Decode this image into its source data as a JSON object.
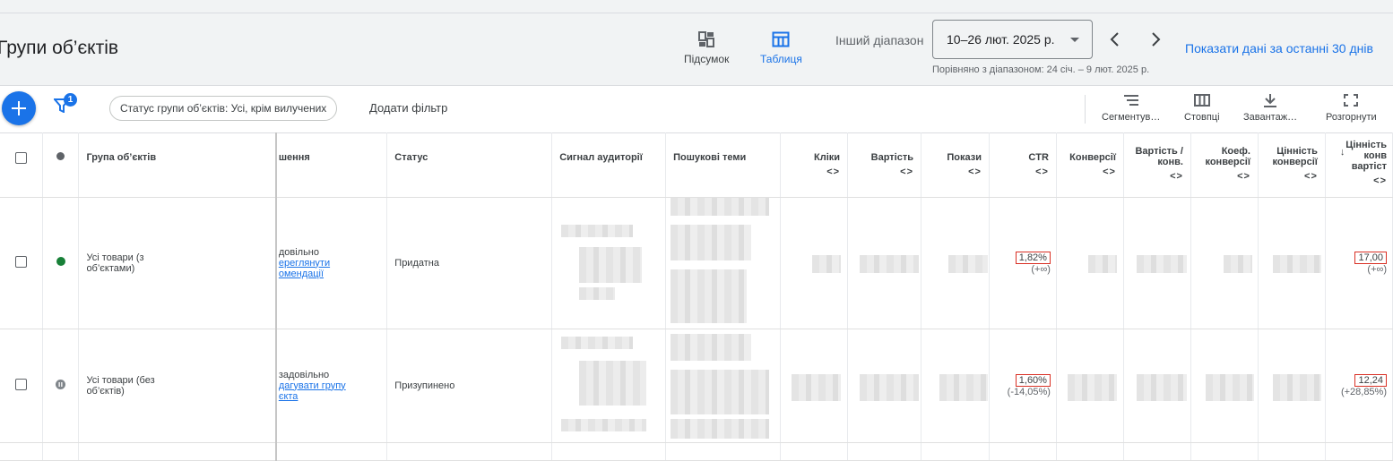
{
  "header": {
    "page_title": "Групи об’єктів",
    "view_summary": "Підсумок",
    "view_table": "Таблиця",
    "range_label": "Інший діапазон",
    "range_value": "10–26 лют. 2025 р.",
    "compare_text": "Порівняно з діапазоном: 24 січ. – 9 лют. 2025 р.",
    "last30_link": "Показати дані за останні 30 днів"
  },
  "toolbar": {
    "filter_badge": "1",
    "status_chip": "Статус групи об’єктів: Усі, крім вилучених",
    "add_filter": "Додати фільтр",
    "segment": "Сегментув…",
    "columns": "Стовпці",
    "download": "Завантаж…",
    "expand": "Розгорнути"
  },
  "table": {
    "headers": {
      "asset_group": "Група об’єктів",
      "ad_strength": "шення",
      "status": "Статус",
      "audience_signal": "Сигнал аудиторії",
      "search_themes": "Пошукові теми",
      "clicks": "Кліки",
      "cost": "Вартість",
      "impressions": "Покази",
      "ctr": "CTR",
      "conversions": "Конверсії",
      "cost_per_conv_1": "Вартість /",
      "cost_per_conv_2": "конв.",
      "conv_rate_1": "Коеф.",
      "conv_rate_2": "конверсії",
      "conv_value_1": "Цінність",
      "conv_value_2": "конверсії",
      "conv_value_cost_1": "Цінність",
      "conv_value_cost_2": "конв",
      "conv_value_cost_3": "вартіст",
      "sort_arrows": "<>",
      "sort_down": "↓"
    },
    "rows": [
      {
        "name_1": "Усі товари (з",
        "name_2": "об’єктами)",
        "status_dot_color": "#188038",
        "ad_strength_1": "довільно",
        "ad_strength_link_1": "ереглянути",
        "ad_strength_link_2": "омендації",
        "status": "Придатна",
        "ctr": "1,82%",
        "ctr_change": "(+∞)",
        "conv_value_cost": "17,00",
        "conv_value_cost_change": "(+∞)"
      },
      {
        "name_1": "Усі товари (без",
        "name_2": "об’єктів)",
        "status_dot_color": "#80868b",
        "ad_strength_1": "задовільно",
        "ad_strength_link_1": "дагувати групу",
        "ad_strength_link_2": "єкта",
        "status": "Призупинено",
        "ctr": "1,60%",
        "ctr_change": "(-14,05%)",
        "conv_value_cost": "12,24",
        "conv_value_cost_change": "(+28,85%)"
      }
    ]
  },
  "colors": {
    "accent": "#1a73e8",
    "eligible": "#188038",
    "paused": "#80868b",
    "highlight_box": "#d93025"
  }
}
